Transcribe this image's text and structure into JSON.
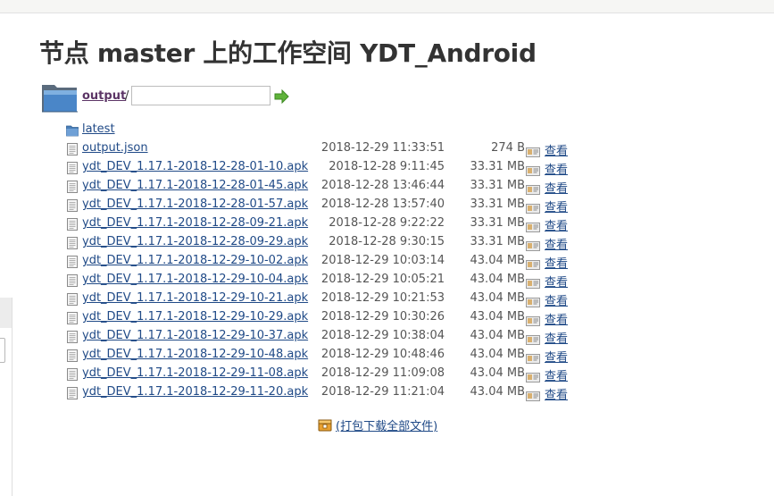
{
  "page": {
    "title": "节点 master 上的工作空间 YDT_Android"
  },
  "path": {
    "crumb": "output",
    "separator": "/",
    "input_value": "",
    "input_placeholder": "",
    "go_icon": "green-arrow-icon"
  },
  "files": [
    {
      "name": "latest",
      "type": "folder",
      "date": "",
      "size": "",
      "view": ""
    },
    {
      "name": "output.json",
      "type": "file",
      "date": "2018-12-29 11:33:51",
      "size": "274 B",
      "view": "查看"
    },
    {
      "name": "ydt_DEV_1.17.1-2018-12-28-01-10.apk",
      "type": "file",
      "date": "2018-12-28 9:11:45",
      "size": "33.31 MB",
      "view": "查看"
    },
    {
      "name": "ydt_DEV_1.17.1-2018-12-28-01-45.apk",
      "type": "file",
      "date": "2018-12-28 13:46:44",
      "size": "33.31 MB",
      "view": "查看"
    },
    {
      "name": "ydt_DEV_1.17.1-2018-12-28-01-57.apk",
      "type": "file",
      "date": "2018-12-28 13:57:40",
      "size": "33.31 MB",
      "view": "查看"
    },
    {
      "name": "ydt_DEV_1.17.1-2018-12-28-09-21.apk",
      "type": "file",
      "date": "2018-12-28 9:22:22",
      "size": "33.31 MB",
      "view": "查看"
    },
    {
      "name": "ydt_DEV_1.17.1-2018-12-28-09-29.apk",
      "type": "file",
      "date": "2018-12-28 9:30:15",
      "size": "33.31 MB",
      "view": "查看"
    },
    {
      "name": "ydt_DEV_1.17.1-2018-12-29-10-02.apk",
      "type": "file",
      "date": "2018-12-29 10:03:14",
      "size": "43.04 MB",
      "view": "查看"
    },
    {
      "name": "ydt_DEV_1.17.1-2018-12-29-10-04.apk",
      "type": "file",
      "date": "2018-12-29 10:05:21",
      "size": "43.04 MB",
      "view": "查看"
    },
    {
      "name": "ydt_DEV_1.17.1-2018-12-29-10-21.apk",
      "type": "file",
      "date": "2018-12-29 10:21:53",
      "size": "43.04 MB",
      "view": "查看"
    },
    {
      "name": "ydt_DEV_1.17.1-2018-12-29-10-29.apk",
      "type": "file",
      "date": "2018-12-29 10:30:26",
      "size": "43.04 MB",
      "view": "查看"
    },
    {
      "name": "ydt_DEV_1.17.1-2018-12-29-10-37.apk",
      "type": "file",
      "date": "2018-12-29 10:38:04",
      "size": "43.04 MB",
      "view": "查看"
    },
    {
      "name": "ydt_DEV_1.17.1-2018-12-29-10-48.apk",
      "type": "file",
      "date": "2018-12-29 10:48:46",
      "size": "43.04 MB",
      "view": "查看"
    },
    {
      "name": "ydt_DEV_1.17.1-2018-12-29-11-08.apk",
      "type": "file",
      "date": "2018-12-29 11:09:08",
      "size": "43.04 MB",
      "view": "查看"
    },
    {
      "name": "ydt_DEV_1.17.1-2018-12-29-11-20.apk",
      "type": "file",
      "date": "2018-12-29 11:21:04",
      "size": "43.04 MB",
      "view": "查看"
    }
  ],
  "download_all": {
    "label": "(打包下载全部文件)",
    "icon": "zip-archive-icon"
  },
  "icons": {
    "folder": "folder-icon",
    "file": "text-file-icon",
    "view": "view-file-icon"
  },
  "colors": {
    "link": "#204a87",
    "visited_link": "#5c3566",
    "text": "#333333",
    "muted": "#555555"
  }
}
